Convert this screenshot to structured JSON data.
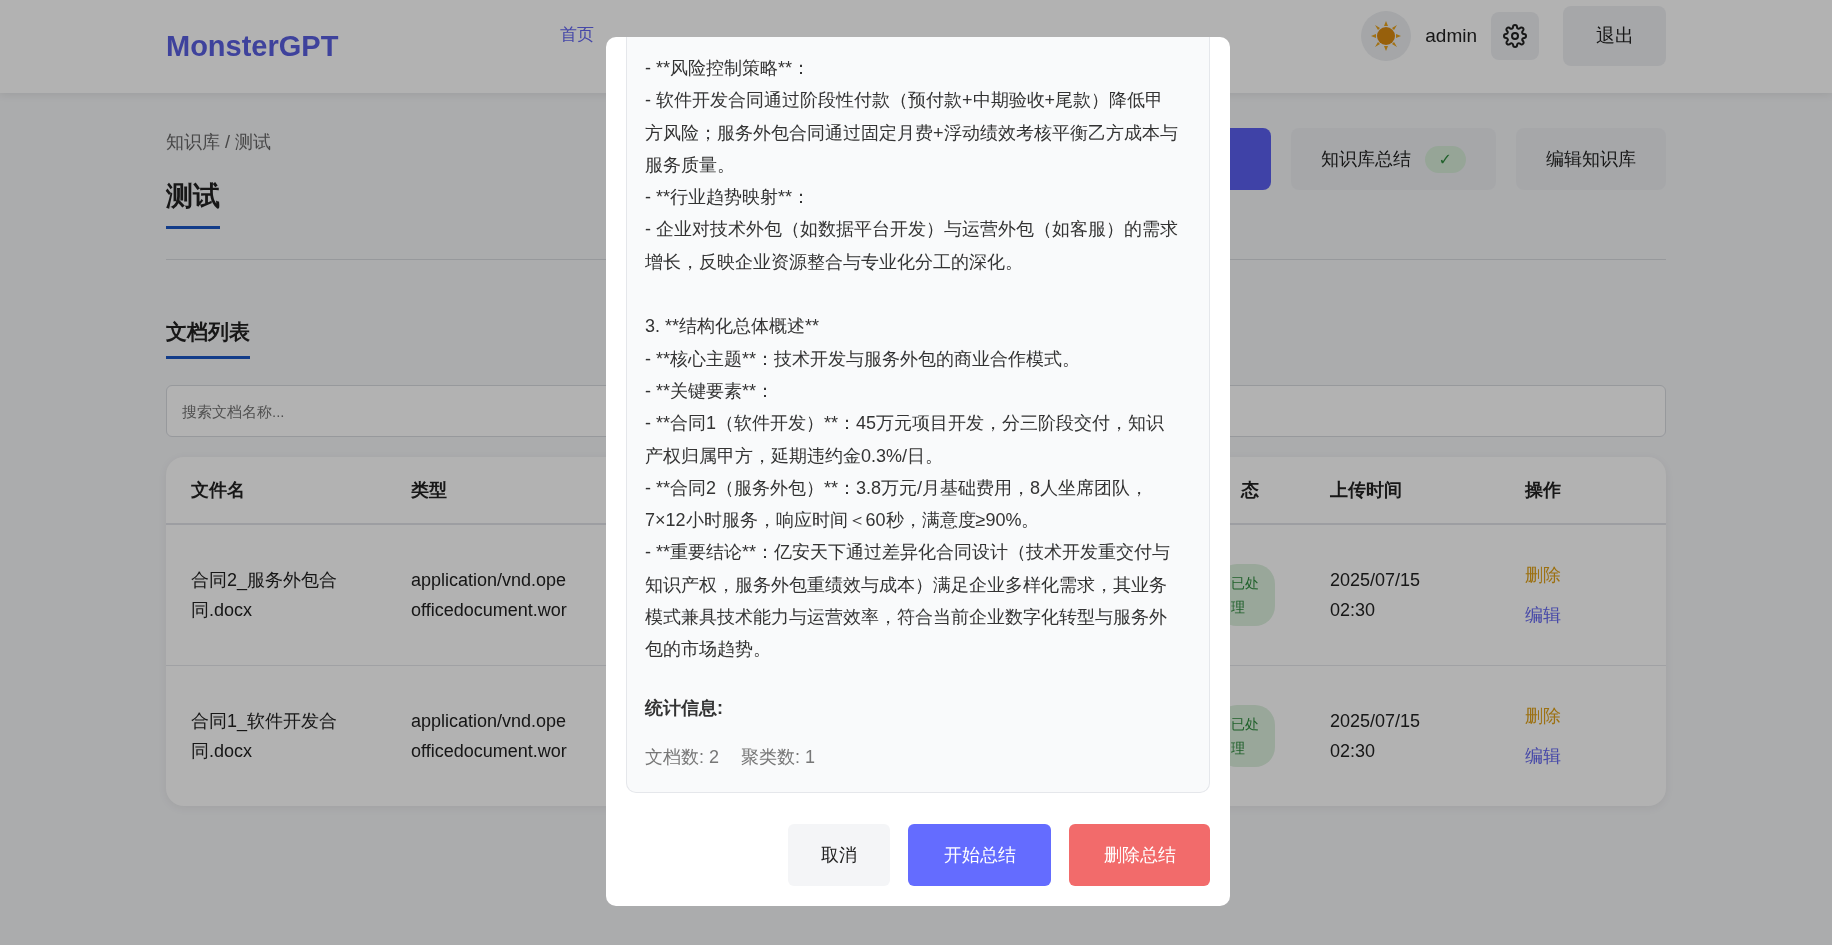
{
  "header": {
    "logo": "MonsterGPT",
    "nav": [
      {
        "label": "首页",
        "selected": false
      }
    ],
    "user": {
      "name": "admin"
    },
    "logout": "退出"
  },
  "page": {
    "breadcrumb": "知识库 / 测试",
    "title": "测试",
    "actions": [
      {
        "kind": "primary"
      },
      {
        "kind": "secondary",
        "label": "知识库总结",
        "badge": "✓"
      },
      {
        "kind": "secondary",
        "label": "编辑知识库"
      }
    ],
    "section_title": "文档列表",
    "search": {
      "placeholder": "搜索文档名称..."
    },
    "table": {
      "columns": [
        "文件名",
        "类型",
        "态",
        "上传时间",
        "操作"
      ],
      "rows": [
        {
          "name": "合同2_服务外包合同.docx",
          "type": [
            "application/vnd.ope",
            "officedocument.wor"
          ],
          "status": "已处理",
          "uploaded": "2025/07/15 02:30",
          "actions": [
            {
              "label": "删除",
              "kind": "delete"
            },
            {
              "label": "编辑",
              "kind": "edit"
            }
          ]
        },
        {
          "name": "合同1_软件开发合同.docx",
          "type": [
            "application/vnd.ope",
            "officedocument.wor"
          ],
          "status": "已处理",
          "uploaded": "2025/07/15 02:30",
          "actions": [
            {
              "label": "删除",
              "kind": "delete"
            },
            {
              "label": "编辑",
              "kind": "edit"
            }
          ]
        }
      ]
    }
  },
  "dialog": {
    "summary": [
      [
        "- **风险控制策略**：",
        "- 软件开发合同通过阶段性付款（预付款+中期验收+尾款）降低甲方风险；服务外包合同通过固定月费+浮动绩效考核平衡乙方成本与服务质量。",
        "- **行业趋势映射**：",
        "- 企业对技术外包（如数据平台开发）与运营外包（如客服）的需求增长，反映企业资源整合与专业化分工的深化。"
      ],
      [
        "3. **结构化总体概述**",
        "- **核心主题**：技术开发与服务外包的商业合作模式。",
        "- **关键要素**：",
        "- **合同1（软件开发）**：45万元项目开发，分三阶段交付，知识产权归属甲方，延期违约金0.3%/日。",
        "- **合同2（服务外包）**：3.8万元/月基础费用，8人坐席团队，7×12小时服务，响应时间＜60秒，满意度≥90%。",
        "- **重要结论**：亿安天下通过差异化合同设计（技术开发重交付与知识产权，服务外包重绩效与成本）满足企业多样化需求，其业务模式兼具技术能力与运营效率，符合当前企业数字化转型与服务外包的市场趋势。"
      ]
    ],
    "stats_title": "统计信息:",
    "stats": [
      "文档数: 2",
      "聚类数: 1"
    ],
    "buttons": [
      {
        "label": "取消",
        "kind": "cancel"
      },
      {
        "label": "开始总结",
        "kind": "primary"
      },
      {
        "label": "删除总结",
        "kind": "danger"
      }
    ]
  }
}
